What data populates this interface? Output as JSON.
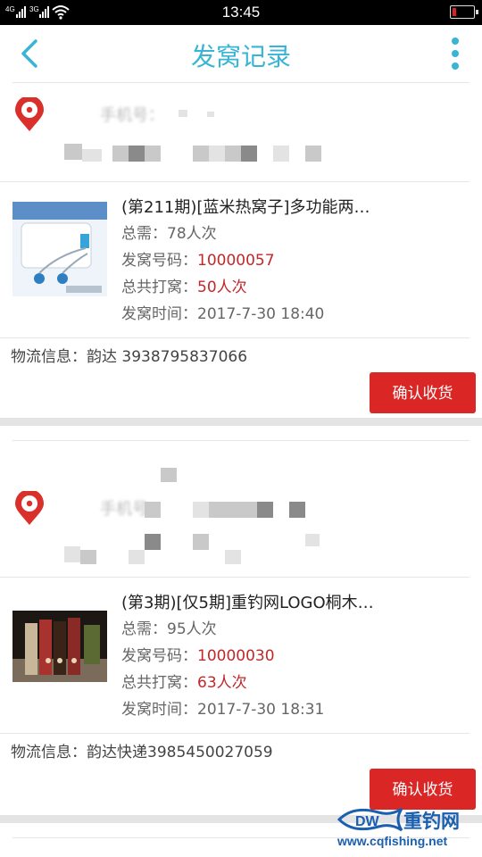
{
  "status_bar": {
    "time": "13:45",
    "signal_1": "4G",
    "signal_2": "3G",
    "battery_level": 0.2
  },
  "header": {
    "title": "发窝记录"
  },
  "records": [
    {
      "address_blur_1": "手机号：",
      "product": {
        "title": "(第211期)[蓝米热窝子]多功能两…",
        "total_label": "总需：",
        "total_value": "78人次",
        "code_label": "发窝号码：",
        "code_value": "10000057",
        "played_label": "总共打窝：",
        "played_count": "50",
        "played_unit": "人次",
        "time_label": "发窝时间：",
        "time_value": "2017-7-30 18:40"
      },
      "logistics": "物流信息：韵达 3938795837066",
      "confirm_label": "确认收货"
    },
    {
      "address_blur_1": "手机号：",
      "product": {
        "title": "(第3期)[仅5期]重钓网LOGO桐木…",
        "total_label": "总需：",
        "total_value": "95人次",
        "code_label": "发窝号码：",
        "code_value": "10000030",
        "played_label": "总共打窝：",
        "played_count": "63",
        "played_unit": "人次",
        "time_label": "发窝时间：",
        "time_value": "2017-7-30 18:31"
      },
      "logistics": "物流信息：韵达快递3985450027059",
      "confirm_label": "确认收货"
    }
  ],
  "watermark": {
    "title": "重钓网",
    "url": "www.cqfishing.net"
  },
  "colors": {
    "accent": "#39b4d6",
    "confirm": "#db2626",
    "pin": "#d9302c",
    "value_red": "#c0282a"
  }
}
